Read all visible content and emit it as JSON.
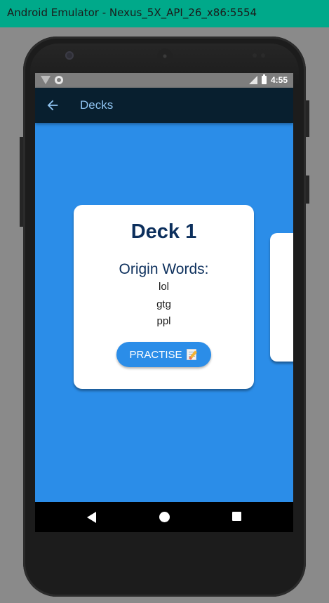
{
  "window": {
    "title": "Android Emulator - Nexus_5X_API_26_x86:5554"
  },
  "statusbar": {
    "time": "4:55"
  },
  "appbar": {
    "title": "Decks"
  },
  "deck_card": {
    "title": "Deck 1",
    "subtitle": "Origin Words:",
    "words": [
      "lol",
      "gtg",
      "ppl"
    ],
    "practise_label": "PRACTISE"
  },
  "icons": {
    "back": "back-arrow-icon",
    "practise": "memo-icon",
    "nav_back": "nav-back-icon",
    "nav_home": "nav-home-icon",
    "nav_recent": "nav-recents-icon"
  },
  "colors": {
    "title_bar": "#00a98a",
    "app_bar": "#081f2f",
    "screen_bg": "#2b8de8",
    "button": "#2b8de8",
    "card_text": "#0c2f5c"
  }
}
